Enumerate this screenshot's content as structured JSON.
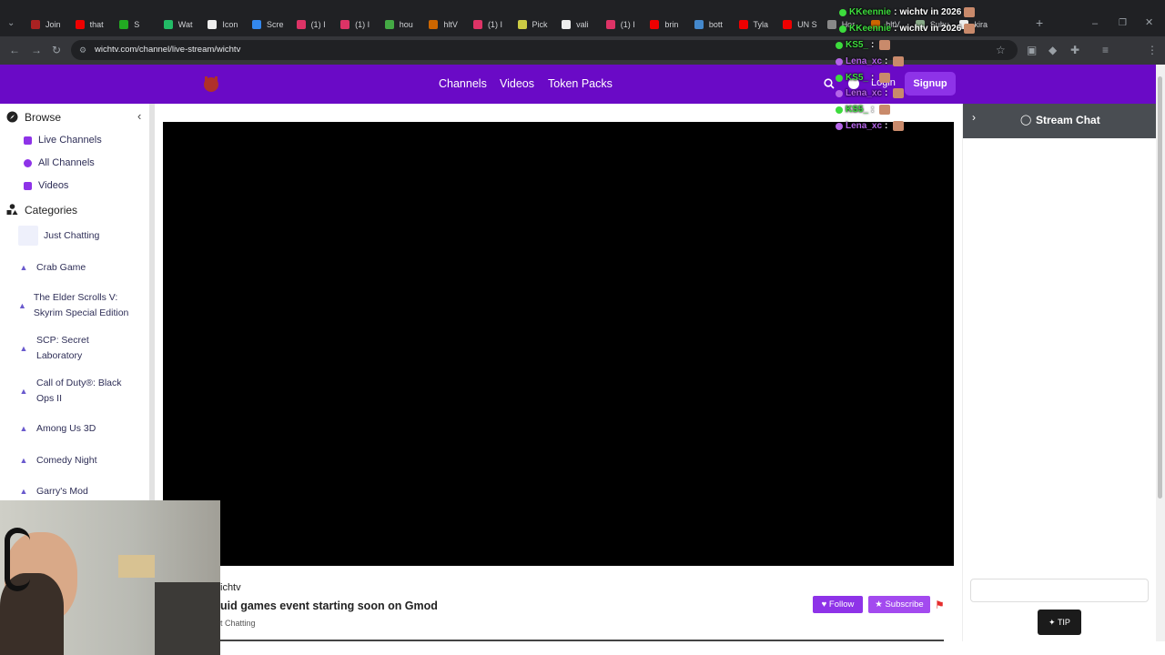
{
  "browser": {
    "tabs": [
      "Join",
      "that",
      "S",
      "Wat",
      "Icon",
      "Scre",
      "(1) I",
      "(1) I",
      "hou",
      "hltV",
      "(1) I",
      "Pick",
      "vali",
      "(1) I",
      "brin",
      "bott",
      "Tyla",
      "UN S",
      "Hor",
      "hltV",
      "Subu",
      "kira"
    ],
    "tab_colors": [
      "#a22",
      "#e00",
      "#2a2",
      "#2b6",
      "#eee",
      "#38e",
      "#d36",
      "#d36",
      "#4a4",
      "#c60",
      "#d36",
      "#cc4",
      "#eee",
      "#d36",
      "#e00",
      "#48c",
      "#e00",
      "#e00",
      "#888",
      "#c60",
      "#8a8",
      "#eee"
    ],
    "url": "wichtv.com/channel/live-stream/wichtv"
  },
  "header": {
    "nav": [
      "Channels",
      "Videos",
      "Token Packs"
    ],
    "login": "Login",
    "signup": "Signup"
  },
  "sidebar": {
    "browse": "Browse",
    "links": [
      "Live Channels",
      "All Channels",
      "Videos"
    ],
    "categories_title": "Categories",
    "categories": [
      "Just Chatting",
      "Crab Game",
      "The Elder Scrolls V: Skyrim Special Edition",
      "SCP: Secret Laboratory",
      "Call of Duty®: Black Ops II",
      "Among Us 3D",
      "Comedy Night",
      "Garry's Mod"
    ]
  },
  "stream": {
    "channel": "ichtv",
    "title": "uid games event starting soon on Gmod",
    "category": "t Chatting",
    "follow": "♥ Follow",
    "subscribe": "★ Subscribe"
  },
  "chat": {
    "title": "Stream Chat",
    "tip": "TIP"
  },
  "overlay": [
    {
      "user": "KKeennie",
      "text": "wichtv in 2026",
      "color": "#3ddc3d"
    },
    {
      "user": "KKeennie",
      "text": "wichtv in 2026",
      "color": "#3ddc3d"
    },
    {
      "user": "KS5_",
      "text": "",
      "color": "#3ddc3d"
    },
    {
      "user": "Lena_xc",
      "text": "",
      "color": "#b565e8"
    },
    {
      "user": "KS5_",
      "text": "",
      "color": "#3ddc3d"
    },
    {
      "user": "Lena_xc",
      "text": "",
      "color": "#b565e8"
    },
    {
      "user": "KS5_",
      "text": "",
      "color": "#3ddc3d"
    },
    {
      "user": "Lena_xc",
      "text": "",
      "color": "#b565e8"
    }
  ]
}
